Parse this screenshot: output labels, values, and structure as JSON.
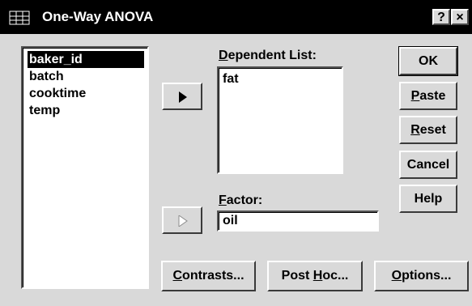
{
  "window": {
    "title": "One-Way ANOVA",
    "help_glyph": "?",
    "close_glyph": "×"
  },
  "variables": {
    "items": [
      "baker_id",
      "batch",
      "cooktime",
      "temp"
    ],
    "selected": "baker_id"
  },
  "dependent": {
    "label_underlined_char": "D",
    "label_rest": "ependent List:",
    "items": [
      "fat"
    ]
  },
  "factor": {
    "label_underlined_char": "F",
    "label_rest": "actor:",
    "value": "oil"
  },
  "side_buttons": {
    "ok": "OK",
    "paste_u": "P",
    "paste_rest": "aste",
    "reset_u": "R",
    "reset_rest": "eset",
    "cancel": "Cancel",
    "help": "Help"
  },
  "bottom_buttons": {
    "contrasts_u": "C",
    "contrasts_rest": "ontrasts...",
    "posthoc_pre": "Post ",
    "posthoc_u": "H",
    "posthoc_rest": "oc...",
    "options_u": "O",
    "options_rest": "ptions..."
  },
  "colors": {
    "titlebar": "#000000",
    "face": "#d9d9d9",
    "selection": "#000000",
    "disabled_text": "#8c8c8c"
  },
  "icons": {
    "app": "spreadsheet-grid-icon",
    "arrow": "right-triangle-icon"
  }
}
